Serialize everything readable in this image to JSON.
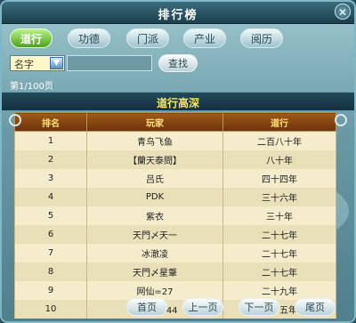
{
  "window": {
    "title": "排行榜",
    "close_label": "✕"
  },
  "tabs": [
    {
      "label": "道行",
      "active": true
    },
    {
      "label": "功德",
      "active": false
    },
    {
      "label": "门派",
      "active": false
    },
    {
      "label": "产业",
      "active": false
    },
    {
      "label": "阅历",
      "active": false
    }
  ],
  "filter": {
    "select_value": "名字",
    "search_value": "",
    "search_button": "查找"
  },
  "page_info": "第1/100页",
  "section_title": "道行高深",
  "table": {
    "headers": [
      "排名",
      "玩家",
      "道行"
    ],
    "rows": [
      [
        "1",
        "青鸟飞鱼",
        "二百八十年"
      ],
      [
        "2",
        "【蘭天泰問】",
        "八十年"
      ],
      [
        "3",
        "吕氏",
        "四十四年"
      ],
      [
        "4",
        "PDK",
        "三十六年"
      ],
      [
        "5",
        "紫衣",
        "三十年"
      ],
      [
        "6",
        "天門〆天一",
        "二十七年"
      ],
      [
        "7",
        "冰澈凌",
        "二十七年"
      ],
      [
        "8",
        "天門〆星鞶",
        "二十七年"
      ],
      [
        "9",
        "网仙=27",
        "二十九年"
      ],
      [
        "10",
        "太阳星=44",
        "二十五年"
      ]
    ]
  },
  "pager": {
    "first": "首页",
    "prev": "上一页",
    "next": "下一页",
    "last": "尾页"
  },
  "colors": {
    "accent_green": "#4aa21c",
    "header_brown": "#7a3d0e",
    "title_gold": "#ffe46b"
  }
}
